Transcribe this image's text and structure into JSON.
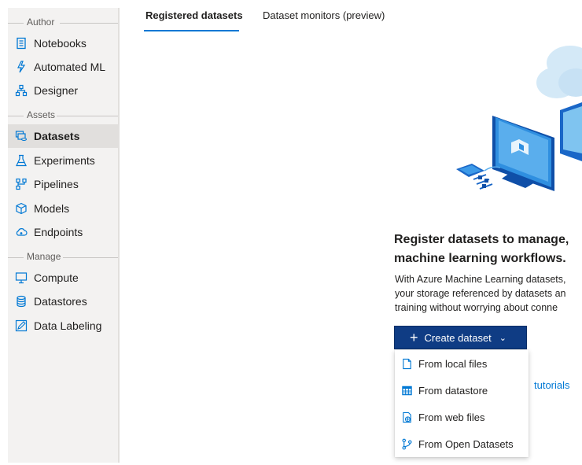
{
  "sidebar": {
    "sections": [
      {
        "header": "Author",
        "items": [
          {
            "label": "Notebooks",
            "icon": "notebook-icon"
          },
          {
            "label": "Automated ML",
            "icon": "automated-ml-icon"
          },
          {
            "label": "Designer",
            "icon": "designer-icon"
          }
        ]
      },
      {
        "header": "Assets",
        "items": [
          {
            "label": "Datasets",
            "icon": "datasets-icon",
            "active": true
          },
          {
            "label": "Experiments",
            "icon": "flask-icon"
          },
          {
            "label": "Pipelines",
            "icon": "pipelines-icon"
          },
          {
            "label": "Models",
            "icon": "cube-icon"
          },
          {
            "label": "Endpoints",
            "icon": "cloud-endpoint-icon"
          }
        ]
      },
      {
        "header": "Manage",
        "items": [
          {
            "label": "Compute",
            "icon": "monitor-icon"
          },
          {
            "label": "Datastores",
            "icon": "database-icon"
          },
          {
            "label": "Data Labeling",
            "icon": "edit-icon"
          }
        ]
      }
    ]
  },
  "tabs": [
    {
      "label": "Registered datasets",
      "active": true
    },
    {
      "label": "Dataset monitors (preview)",
      "active": false
    }
  ],
  "empty_state": {
    "headline": [
      "Register datasets to manage,",
      "machine learning workflows."
    ],
    "description": [
      "With Azure Machine Learning datasets,",
      "your storage referenced by datasets an",
      "training without worrying about conne"
    ],
    "create_button": "Create dataset",
    "tutorials_link": "tutorials"
  },
  "create_menu": [
    {
      "label": "From local files",
      "icon": "file-icon"
    },
    {
      "label": "From datastore",
      "icon": "table-icon"
    },
    {
      "label": "From web files",
      "icon": "web-file-icon"
    },
    {
      "label": "From Open Datasets",
      "icon": "open-datasets-icon"
    }
  ],
  "colors": {
    "accent": "#0078d4",
    "button": "#0f3c84",
    "sidebar": "#f3f2f1",
    "active_item": "#e1dfdd"
  }
}
